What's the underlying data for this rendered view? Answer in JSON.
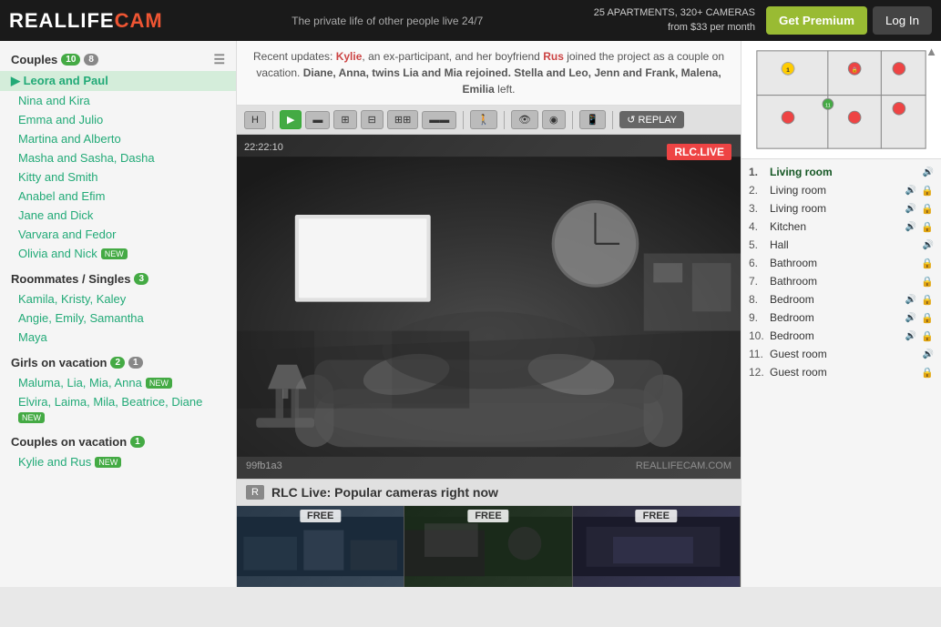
{
  "header": {
    "logo_reallife": "REALLIFE",
    "logo_cam": "CAM",
    "tagline": "The private life of other people live 24/7",
    "stats_line1": "25 APARTMENTS, 320+ CAMERAS",
    "stats_line2": "from $33 per month",
    "btn_premium": "Get Premium",
    "btn_login": "Log In"
  },
  "notice": {
    "text_before": "Recent updates: ",
    "kylie": "Kylie",
    "text1": ", an ex-participant, and her boyfriend ",
    "rus": "Rus",
    "text2": " joined the project as a couple on vacation. ",
    "diane": "Diane, Anna, twins Lia and Mia rejoined.",
    "text3": " ",
    "stella": "Stella and Leo, Jenn and Frank, Malena, Emilia",
    "text4": " left."
  },
  "sidebar": {
    "couples_label": "Couples",
    "couples_count1": "10",
    "couples_count2": "8",
    "couples": [
      {
        "name": "Leora and Paul",
        "active": true
      },
      {
        "name": "Nina and Kira"
      },
      {
        "name": "Emma and Julio"
      },
      {
        "name": "Martina and Alberto"
      },
      {
        "name": "Masha and Sasha, Dasha"
      },
      {
        "name": "Kitty and Smith"
      },
      {
        "name": "Anabel and Efim"
      },
      {
        "name": "Jane and Dick"
      },
      {
        "name": "Varvara and Fedor"
      },
      {
        "name": "Olivia and Nick",
        "new": true
      }
    ],
    "roommates_label": "Roommates / Singles",
    "roommates_count": "3",
    "roommates": [
      {
        "name": "Kamila, Kristy, Kaley"
      },
      {
        "name": "Angie, Emily, Samantha"
      },
      {
        "name": "Maya"
      }
    ],
    "girls_label": "Girls on vacation",
    "girls_count1": "2",
    "girls_count2": "1",
    "girls": [
      {
        "name": "Maluma, Lia, Mia, Anna",
        "new": true
      },
      {
        "name": "Elvira, Laima, Mila, Beatrice, Diane",
        "new": true
      }
    ],
    "couples_vacation_label": "Couples on vacation",
    "couples_vacation_count": "1",
    "couples_vacation": [
      {
        "name": "Kylie and Rus",
        "new": true
      }
    ]
  },
  "video": {
    "timestamp": "22:22:10",
    "live_badge": "RLC.LIVE",
    "watermark": "REALLIFECAM.COM",
    "video_id": "99fb1a3"
  },
  "toolbar": {
    "buttons": [
      "H",
      "▶",
      "▬",
      "⊞⊟",
      "⊞",
      "⊡⊡⊡⊡",
      "▬▬",
      "●",
      "👁",
      "◉",
      "📱",
      "↺",
      "REPLAY"
    ]
  },
  "cameras": [
    {
      "num": "1.",
      "name": "Living room",
      "sound": true,
      "lock": false,
      "active": true
    },
    {
      "num": "2.",
      "name": "Living room",
      "sound": true,
      "lock": true
    },
    {
      "num": "3.",
      "name": "Living room",
      "sound": true,
      "lock": true
    },
    {
      "num": "4.",
      "name": "Kitchen",
      "sound": true,
      "lock": true
    },
    {
      "num": "5.",
      "name": "Hall",
      "sound": true,
      "lock": false
    },
    {
      "num": "6.",
      "name": "Bathroom",
      "sound": false,
      "lock": true
    },
    {
      "num": "7.",
      "name": "Bathroom",
      "sound": false,
      "lock": true
    },
    {
      "num": "8.",
      "name": "Bedroom",
      "sound": true,
      "lock": true
    },
    {
      "num": "9.",
      "name": "Bedroom",
      "sound": true,
      "lock": true
    },
    {
      "num": "10.",
      "name": "Bedroom",
      "sound": true,
      "lock": true
    },
    {
      "num": "11.",
      "name": "Guest room",
      "sound": true,
      "lock": false
    },
    {
      "num": "12.",
      "name": "Guest room",
      "sound": false,
      "lock": true
    }
  ],
  "bottom": {
    "rlc_icon": "R",
    "popular_title": "RLC Live: Popular cameras right now"
  },
  "thumbnails": [
    {
      "label": "FREE",
      "style": "thumb-bg1"
    },
    {
      "label": "FREE",
      "style": "thumb-bg2"
    },
    {
      "label": "FREE",
      "style": "thumb-bg3"
    }
  ]
}
